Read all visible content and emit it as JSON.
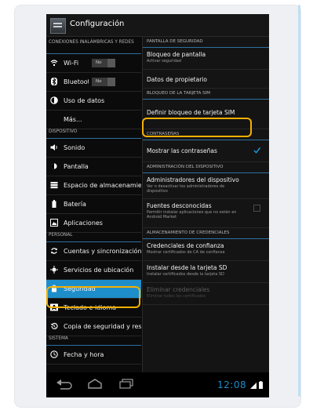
{
  "window": {
    "title": "Configuración"
  },
  "sidebar": {
    "sections": [
      {
        "label": "CONEXIONES INALÁMBRICAS Y REDES"
      },
      {
        "label": "DISPOSITIVO"
      },
      {
        "label": "PERSONAL"
      },
      {
        "label": "SISTEMA"
      }
    ],
    "items": [
      {
        "label": "Wi-Fi",
        "icon": "wifi-icon",
        "toggle": "No"
      },
      {
        "label": "Bluetooth",
        "icon": "bluetooth-icon",
        "toggle": "No"
      },
      {
        "label": "Uso de datos",
        "icon": "data-usage-icon"
      },
      {
        "label": "Más..."
      },
      {
        "label": "Sonido",
        "icon": "sound-icon"
      },
      {
        "label": "Pantalla",
        "icon": "display-icon"
      },
      {
        "label": "Espacio de almacenamiento",
        "icon": "storage-icon"
      },
      {
        "label": "Batería",
        "icon": "battery-icon"
      },
      {
        "label": "Aplicaciones",
        "icon": "apps-icon"
      },
      {
        "label": "Cuentas y sincronización",
        "icon": "sync-icon"
      },
      {
        "label": "Servicios de ubicación",
        "icon": "location-icon"
      },
      {
        "label": "Seguridad",
        "icon": "lock-icon",
        "selected": true
      },
      {
        "label": "Teclado e idioma",
        "icon": "keyboard-icon"
      },
      {
        "label": "Copia de seguridad y restablecimiento",
        "icon": "backup-icon"
      },
      {
        "label": "Fecha y hora",
        "icon": "clock-icon"
      }
    ]
  },
  "security": {
    "sections": [
      {
        "label": "PANTALLA DE SEGURIDAD"
      },
      {
        "label": "BLOQUEO DE LA TARJETA SIM"
      },
      {
        "label": "CONTRASEÑAS"
      },
      {
        "label": "ADMINISTRACIÓN DEL DISPOSITIVO"
      },
      {
        "label": "ALMACENAMIENTO DE CREDENCIALES"
      }
    ],
    "items": [
      {
        "title": "Bloqueo de pantalla",
        "summary": "Activar seguridad"
      },
      {
        "title": "Datos de propietario",
        "summary": ""
      },
      {
        "title": "Definir bloqueo de tarjeta SIM",
        "summary": ""
      },
      {
        "title": "Mostrar las contraseñas",
        "summary": "",
        "checked": true
      },
      {
        "title": "Administradores del dispositivo",
        "summary": "Ver o desactivar los administradores de dispositivo"
      },
      {
        "title": "Fuentes desconocidas",
        "summary": "Permitir instalar aplicaciones que no estén en Android Market",
        "checked": false
      },
      {
        "title": "Credenciales de confianza",
        "summary": "Mostrar certificados de CA de confianza"
      },
      {
        "title": "Instalar desde la tarjeta SD",
        "summary": "Instalar certificados desde la tarjeta SD"
      },
      {
        "title": "Eliminar credenciales",
        "summary": "Eliminar todos los certificados",
        "disabled": true
      }
    ]
  },
  "status_bar": {
    "time": "12:08"
  },
  "colors": {
    "accent": "#1e8ecb",
    "highlight": "#f5b000",
    "background": "#0b0b0b"
  }
}
